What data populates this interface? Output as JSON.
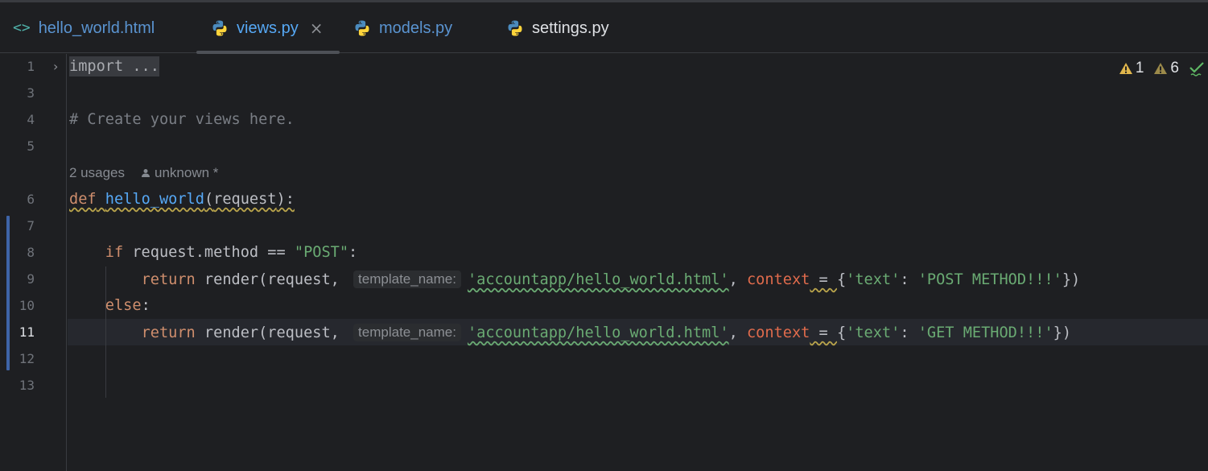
{
  "tabs": [
    {
      "label": "hello_world.html",
      "icon": "html-file-icon",
      "active": false
    },
    {
      "label": "views.py",
      "icon": "python-file-icon",
      "active": true
    },
    {
      "label": "models.py",
      "icon": "python-file-icon",
      "active": false
    },
    {
      "label": "settings.py",
      "icon": "python-file-icon",
      "active": false
    }
  ],
  "close_glyph": "×",
  "inspections": {
    "warnings": "1",
    "weak_warnings": "6"
  },
  "code_lens": {
    "usages": "2 usages",
    "author": "unknown *"
  },
  "line_numbers": {
    "l1": "1",
    "l3": "3",
    "l4": "4",
    "l5": "5",
    "l6": "6",
    "l7": "7",
    "l8": "8",
    "l9": "9",
    "l10": "10",
    "l11": "11",
    "l12": "12",
    "l13": "13"
  },
  "current_line": "11",
  "code": {
    "line1": "import ...",
    "line4": "# Create your views here.",
    "line6": {
      "kw": "def",
      "name": "hello_world",
      "open": "(",
      "param": "request",
      "close": "):"
    },
    "line8": {
      "kw": "if",
      "text": " request.method == ",
      "str": "\"POST\"",
      "end": ":"
    },
    "line9": {
      "kw": "return",
      "call": " render(request, ",
      "hint": "template_name:",
      "str": "'accountapp/hello_world.html'",
      "comma": ", ",
      "named": "context",
      "eq": " = ",
      "brace_open": "{",
      "key": "'text'",
      "colon": ": ",
      "value": "'POST METHOD!!!'",
      "close": "})"
    },
    "line10": {
      "kw": "else",
      "end": ":"
    },
    "line11": {
      "kw": "return",
      "call": " render(request, ",
      "hint": "template_name:",
      "str": "'accountapp/hello_world.html'",
      "comma": ", ",
      "named": "context",
      "eq": " = ",
      "brace_open": "{",
      "key": "'text'",
      "colon": ": ",
      "value": "'GET METHOD!!!'",
      "close": "})"
    }
  },
  "colors": {
    "background": "#1e1f22",
    "keyword": "#cf8e6d",
    "function": "#56a8f5",
    "string": "#6aab73",
    "comment": "#7a7e85",
    "named_arg": "#e06b4c",
    "change_marker": "#3e64a8",
    "warning": "#e0b64c"
  }
}
